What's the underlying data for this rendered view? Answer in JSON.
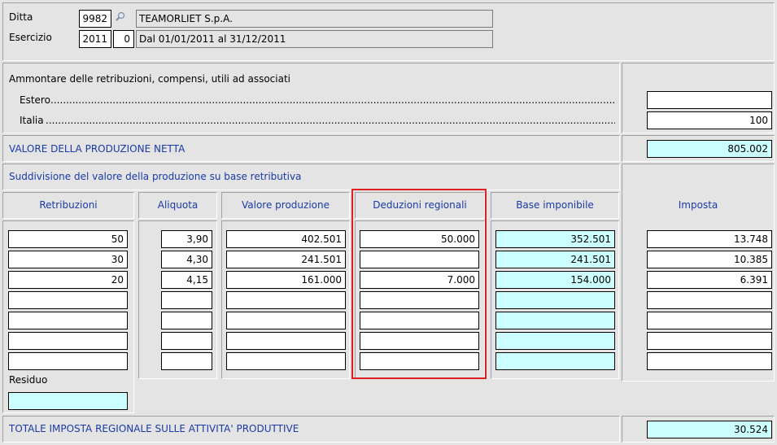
{
  "header": {
    "ditta_label": "Ditta",
    "ditta_code": "9982",
    "ditta_name": "TEAMORLIET S.p.A.",
    "esercizio_label": "Esercizio",
    "esercizio_year": "2011",
    "esercizio_num": "0",
    "esercizio_period": "Dal 01/01/2011 al 31/12/2011"
  },
  "ammontare": {
    "title": "Ammontare delle retribuzioni, compensi, utili ad associati",
    "estero_label": "Estero",
    "estero_value": "",
    "italia_label": "Italia",
    "italia_value": "100"
  },
  "valore_netta": {
    "label": "VALORE DELLA PRODUZIONE NETTA",
    "value": "805.002"
  },
  "suddivisione": {
    "title": "Suddivisione del valore della produzione su base retributiva",
    "columns": [
      "Retribuzioni",
      "Aliquota",
      "Valore produzione",
      "Deduzioni regionali",
      "Base imponibile",
      "Imposta"
    ],
    "rows": [
      [
        "50",
        "3,90",
        "402.501",
        "50.000",
        "352.501",
        "13.748"
      ],
      [
        "30",
        "4,30",
        "241.501",
        "",
        "241.501",
        "10.385"
      ],
      [
        "20",
        "4,15",
        "161.000",
        "7.000",
        "154.000",
        "6.391"
      ],
      [
        "",
        "",
        "",
        "",
        "",
        ""
      ],
      [
        "",
        "",
        "",
        "",
        "",
        ""
      ],
      [
        "",
        "",
        "",
        "",
        "",
        ""
      ],
      [
        "",
        "",
        "",
        "",
        "",
        ""
      ]
    ],
    "residuo_label": "Residuo",
    "residuo_value": ""
  },
  "totale": {
    "label": "TOTALE IMPOSTA REGIONALE SULLE ATTIVITA' PRODUTTIVE",
    "value": "30.524"
  },
  "colors": {
    "background": "#e4e4e4",
    "label_blue": "#1a3aa8",
    "computed_field": "#ccffff",
    "highlight_border": "#e02020"
  }
}
